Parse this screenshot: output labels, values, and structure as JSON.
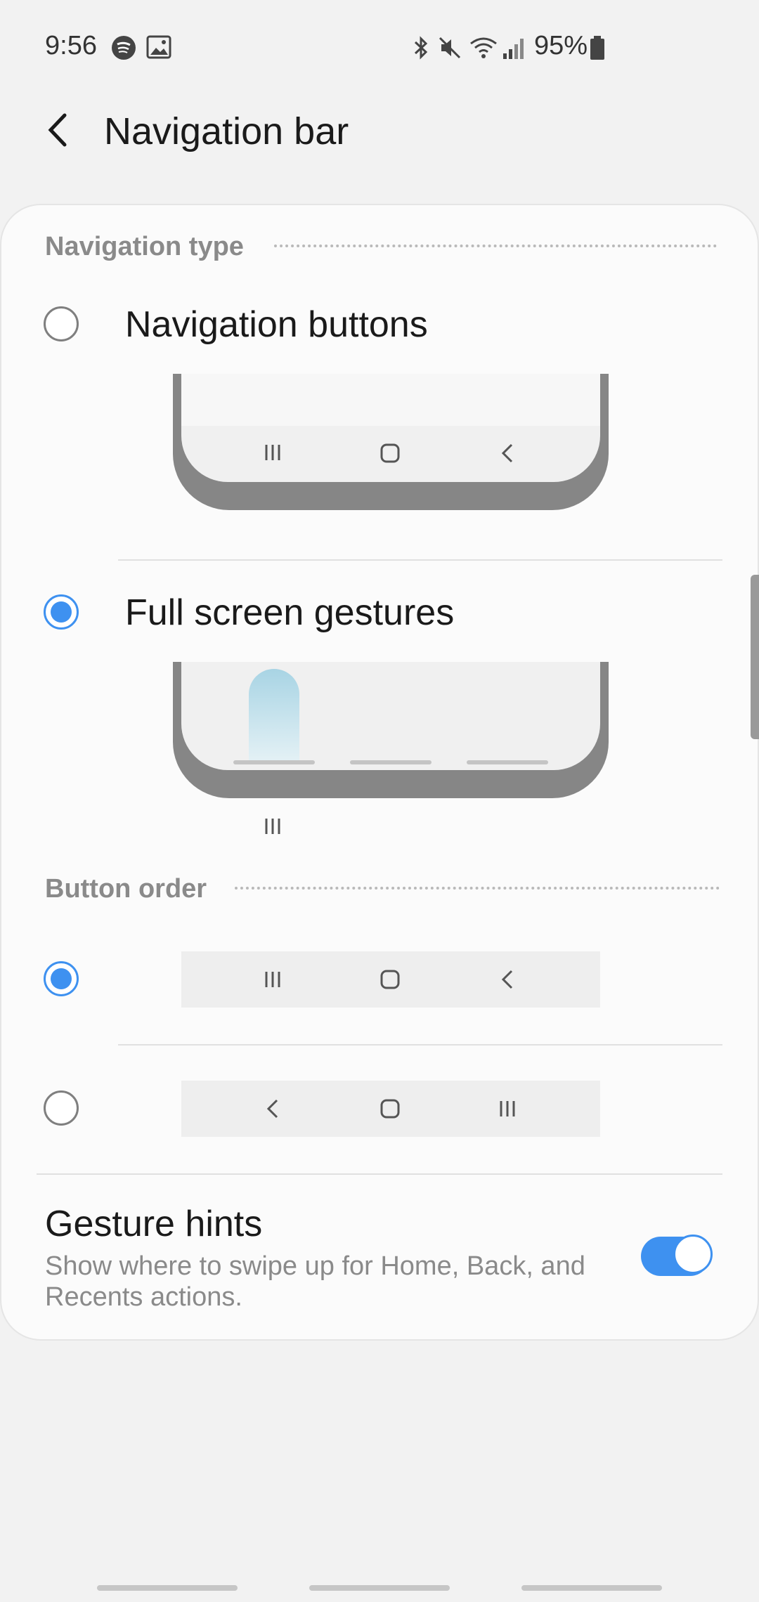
{
  "status_bar": {
    "time": "9:56",
    "battery_percent": "95%",
    "left_icons": [
      "spotify-icon",
      "gallery-icon"
    ],
    "right_icons": [
      "bluetooth-icon",
      "mute-icon",
      "wifi-icon",
      "signal-icon",
      "battery-icon"
    ]
  },
  "header": {
    "title": "Navigation bar",
    "back_icon": "back-arrow-icon"
  },
  "navigation_type": {
    "section_title": "Navigation type",
    "options": [
      {
        "label": "Navigation buttons",
        "selected": false
      },
      {
        "label": "Full screen gestures",
        "selected": true
      }
    ]
  },
  "button_order": {
    "section_title": "Button order",
    "options": [
      {
        "sequence": [
          "recents-icon",
          "home-icon",
          "back-icon"
        ],
        "selected": true
      },
      {
        "sequence": [
          "back-icon",
          "home-icon",
          "recents-icon"
        ],
        "selected": false
      }
    ]
  },
  "gesture_hints": {
    "title": "Gesture hints",
    "description": "Show where to swipe up for Home, Back, and Recents actions.",
    "enabled": true
  },
  "colors": {
    "accent": "#3e91f0",
    "background": "#f2f2f2",
    "card": "#fbfbfb",
    "section_title": "#8a8a8a"
  }
}
